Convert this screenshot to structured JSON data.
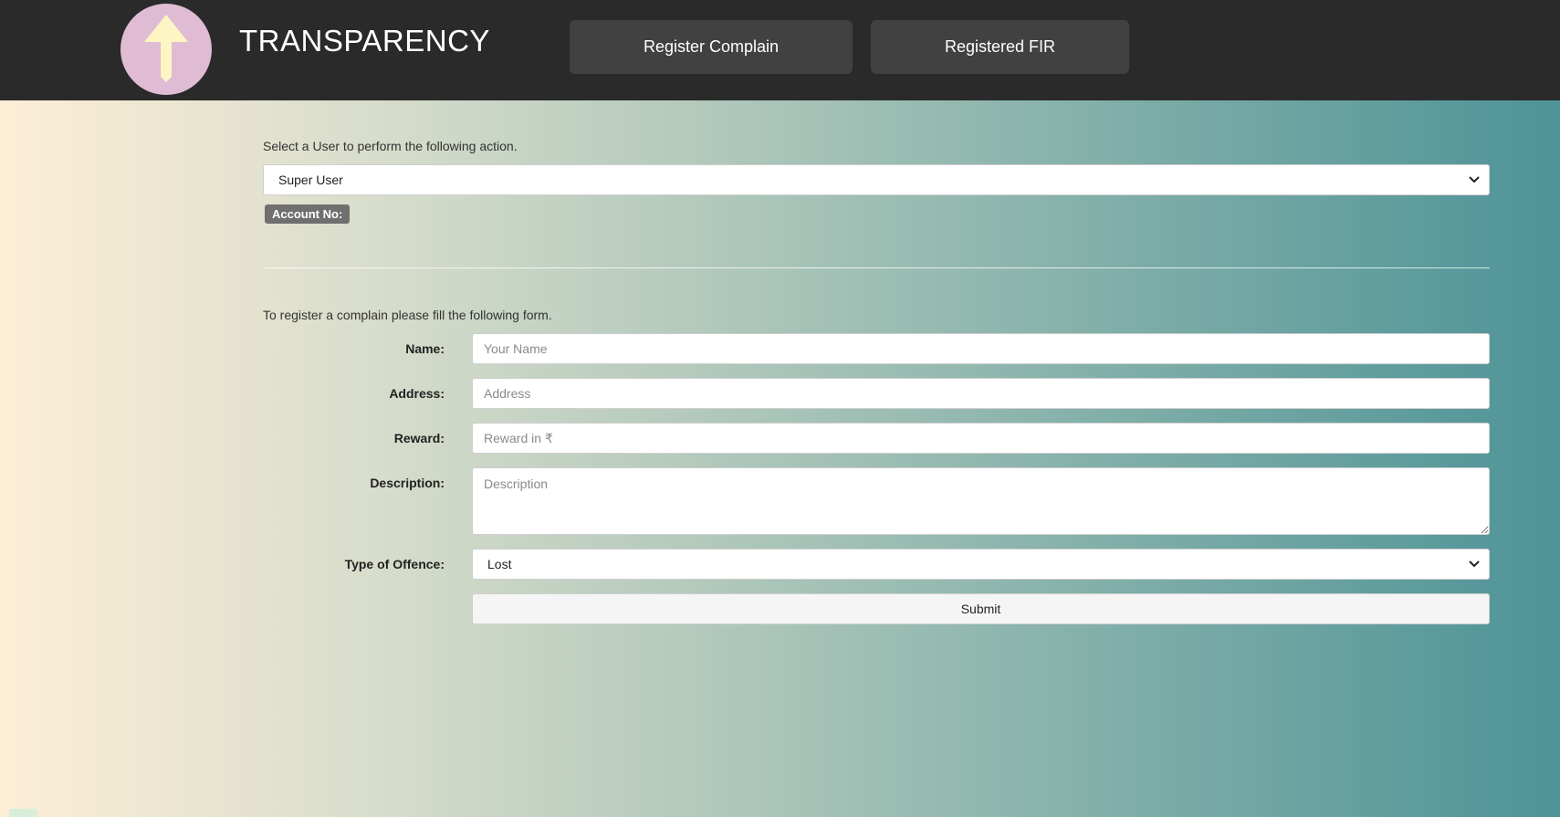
{
  "header": {
    "brand": "TRANSPARENCY",
    "nav": {
      "register_complain": "Register Complain",
      "registered_fir": "Registered FIR"
    }
  },
  "user_section": {
    "hint": "Select a User to perform the following action.",
    "selected_user": "Super User",
    "account_badge": "Account No:"
  },
  "complain_form": {
    "hint": "To register a complain please fill the following form.",
    "name_label": "Name:",
    "name_placeholder": "Your Name",
    "address_label": "Address:",
    "address_placeholder": "Address",
    "reward_label": "Reward:",
    "reward_placeholder": "Reward in ₹",
    "description_label": "Description:",
    "description_placeholder": "Description",
    "offence_label": "Type of Offence:",
    "offence_selected": "Lost",
    "submit_label": "Submit"
  },
  "icons": {
    "logo": "up-arrow-icon",
    "dropdown": "chevron-down-icon"
  },
  "colors": {
    "topbar": "#2a2a2a",
    "nav_button": "#414141",
    "logo_circle": "#dfbcd4",
    "logo_arrow": "#fdf6c4",
    "gradient_start": "#fdeed6",
    "gradient_end": "#4e9398"
  }
}
